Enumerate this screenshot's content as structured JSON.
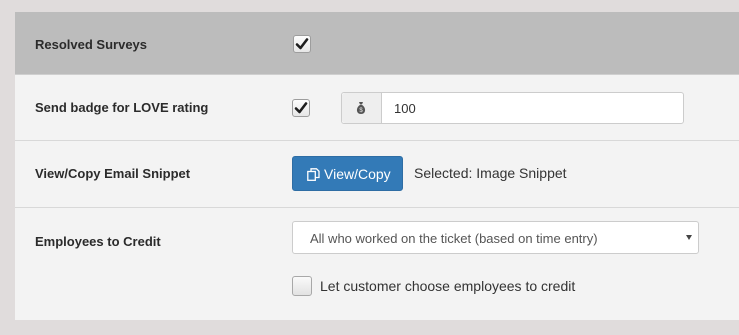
{
  "rows": {
    "resolved_surveys": {
      "label": "Resolved Surveys",
      "checked": true
    },
    "send_badge": {
      "label": "Send badge for LOVE rating",
      "checked": true,
      "addon_icon": "money-bag-icon",
      "value": "100"
    },
    "view_copy": {
      "label": "View/Copy Email Snippet",
      "button_icon": "copy-icon",
      "button_label": "View/Copy",
      "selected_text": "Selected: Image Snippet"
    },
    "employees_to_credit": {
      "label": "Employees to Credit",
      "selected_option": "All who worked on the ticket (based on time entry)",
      "checkbox_label": "Let customer choose employees to credit",
      "checkbox_checked": false
    }
  },
  "colors": {
    "primary_button": "#337ab7",
    "header_row_bg": "#bcbcbc",
    "panel_bg": "#f3f3f3"
  }
}
